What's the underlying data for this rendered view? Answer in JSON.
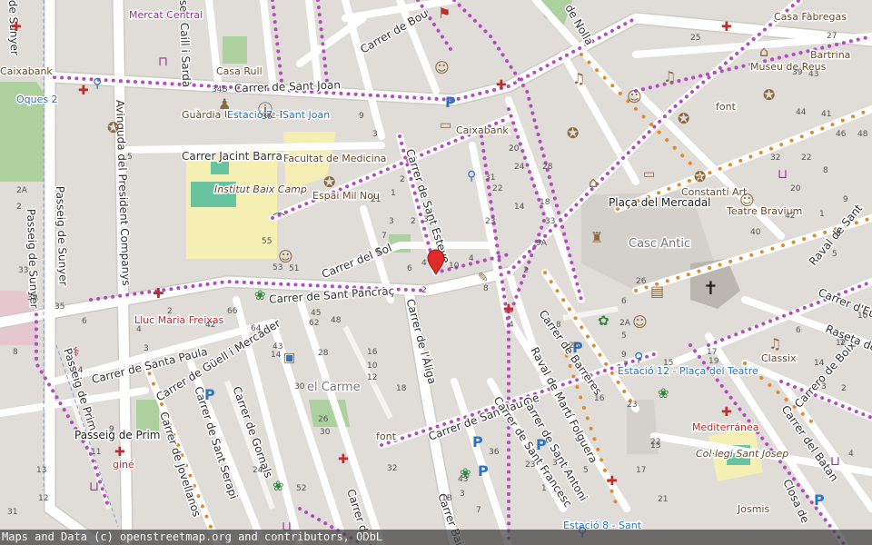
{
  "map": {
    "streets": [
      {
        "id": "sant-joan",
        "name": "Carrer de Sant Joan"
      },
      {
        "id": "jacint-barrau",
        "name": "Carrer Jacint Barrau"
      },
      {
        "id": "sant-pancrac",
        "name": "Carrer de Sant Pancraç"
      },
      {
        "id": "sol",
        "name": "Carrer del Sol"
      },
      {
        "id": "sant-esteve",
        "name": "Carrer de Sant Esteve"
      },
      {
        "id": "aliga",
        "name": "Carrer de l'Àliga"
      },
      {
        "id": "santa-paula",
        "name": "Carrer de Santa Paula"
      },
      {
        "id": "guell",
        "name": "Carrer de Güell i Mercader"
      },
      {
        "id": "gomis",
        "name": "Carrer de Gornals"
      },
      {
        "id": "serapi",
        "name": "Carrer de Sant Serapi"
      },
      {
        "id": "jovellanos",
        "name": "Carrer de Jovellanos"
      },
      {
        "id": "sant-jaume",
        "name": "Carrer de Sant Jaume"
      },
      {
        "id": "sant-francesc",
        "name": "Carrer de Sant Francesc"
      },
      {
        "id": "sant-antoni",
        "name": "Carrer de Sant Antoni"
      },
      {
        "id": "barreres",
        "name": "Carrer de Barreres"
      },
      {
        "id": "raval-marti",
        "name": "Raval de Martí Folguera"
      },
      {
        "id": "boix",
        "name": "Carrero de Boix"
      },
      {
        "id": "batan",
        "name": "Carrer del Batan"
      },
      {
        "id": "eug",
        "name": "Carrer d'Eug"
      },
      {
        "id": "raseta",
        "name": "Raseta de"
      },
      {
        "id": "raval-sant",
        "name": "Raval de Sant"
      },
      {
        "id": "closa",
        "name": "Closa de"
      },
      {
        "id": "baix",
        "name": "Carrer Baix"
      },
      {
        "id": "del-c",
        "name": "Carrer del C"
      },
      {
        "id": "bou",
        "name": "Carrer de Bou"
      },
      {
        "id": "nolla",
        "name": "de Nolla"
      },
      {
        "id": "president",
        "name": "Avinguda del President Companys"
      },
      {
        "id": "sunyer",
        "name": "Passeig de Sunyer"
      },
      {
        "id": "sunyer2",
        "name": "de Sunyer"
      },
      {
        "id": "prim",
        "name": "Passeig de Prim"
      },
      {
        "id": "caill",
        "name": "sep Caill i Sardà"
      }
    ],
    "places": {
      "placa_mercadal": "Plaça del Mercadal",
      "casc_antic": "Casc Antic",
      "el_carme": "el Carme",
      "passeig_prim": "Passeig de Prim"
    },
    "pois": {
      "mercat_central": "Mercat Central",
      "casa_rull": "Casa Rull",
      "guardia_urbana": "Guàrdia Urbana de Reus",
      "estacio7": "Estació 7 - Sant Joan",
      "caixabank": "Caixabank",
      "caixabank2": "Caixabank",
      "facultat": "Facultat de Medicina",
      "institut": "Institut Baix Camp",
      "espai_mil_nou": "Espai Mil Nou",
      "lluc_maria": "Lluc Maria Freixas",
      "estacio12": "Estació 12 - Plaça del Teatre",
      "estacio8": "Estació 8 - Sant",
      "mediterranea": "Mediterránea",
      "col_legi": "Col·legi Sant Josep",
      "josmis": "Josmis",
      "classix": "Classix",
      "teatre_bravium": "Teatre Bravium",
      "constanti_art": "Constantí Art",
      "museu_reus": "Museu de Reus",
      "casa_fabregas": "Casa Fàbregas",
      "bartrina": "Bartrina",
      "font1": "font",
      "font2": "font",
      "oques": "Oques 2",
      "gine": "giné"
    },
    "house_numbers": [
      "34B",
      "36",
      "5",
      "9",
      "3",
      "2",
      "1",
      "21",
      "3",
      "2",
      "7",
      "5",
      "3",
      "4",
      "10",
      "4",
      "6",
      "2",
      "23",
      "31",
      "22",
      "24",
      "14",
      "18",
      "28",
      "20",
      "8",
      "26",
      "16",
      "9",
      "7",
      "5",
      "3",
      "1",
      "55",
      "53",
      "51",
      "66",
      "64",
      "62",
      "45",
      "48",
      "42",
      "43",
      "30",
      "28",
      "32",
      "16",
      "10",
      "12",
      "14",
      "52",
      "24",
      "26",
      "30",
      "18",
      "1B",
      "6",
      "2A",
      "5",
      "23",
      "22",
      "21",
      "17",
      "19",
      "26",
      "13",
      "15",
      "17",
      "36",
      "43",
      "23",
      "3",
      "7",
      "2",
      "4",
      "9A",
      "8",
      "33",
      "32",
      "22",
      "20",
      "8",
      "10",
      "12",
      "14",
      "2",
      "3",
      "4",
      "5",
      "6",
      "7",
      "8",
      "9",
      "1",
      "40",
      "42",
      "44",
      "46",
      "48",
      "27",
      "25",
      "39",
      "41",
      "43",
      "2A",
      "2",
      "13",
      "31",
      "12",
      "33",
      "39",
      "11",
      "9",
      "4",
      "3",
      "2",
      "6",
      "8",
      "35",
      "14",
      "16",
      "4",
      "2"
    ],
    "marker": {
      "label": "selected location"
    }
  },
  "attribution": "Maps and Data (c) openstreetmap.org and contributors, ODbL",
  "colors": {
    "background": "#e0dcd8",
    "road": "#ffffff",
    "green": "#add19e",
    "school": "#f6efb4",
    "square": "#d4d0cc",
    "marker": "#e02a2a",
    "route_purple": "#b44bc0",
    "route_orange": "#e08a2c"
  }
}
